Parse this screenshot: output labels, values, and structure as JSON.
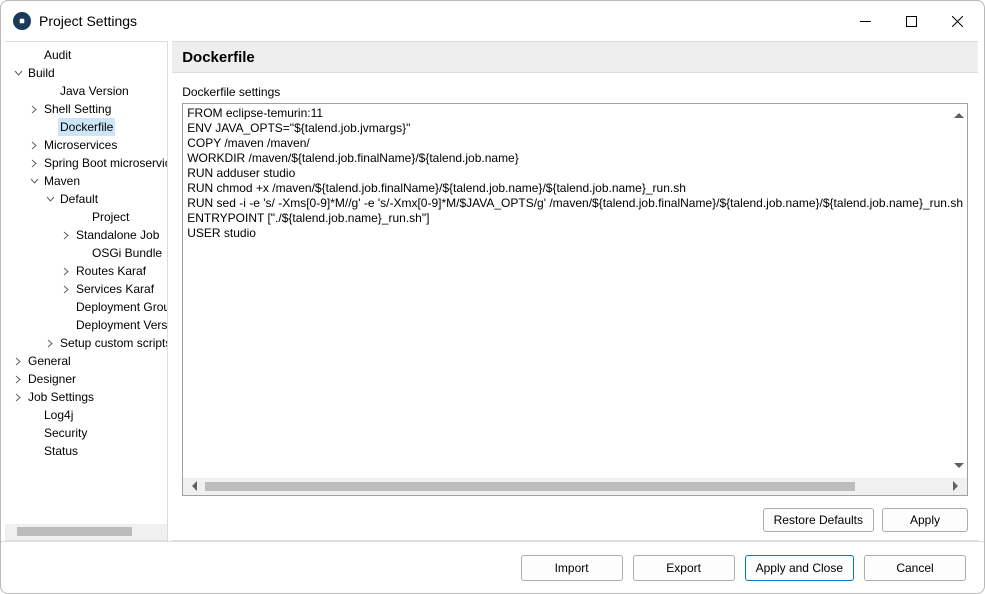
{
  "window": {
    "title": "Project Settings",
    "controls": {
      "minimize": "Minimize",
      "maximize": "Maximize",
      "close": "Close"
    }
  },
  "tree": {
    "items": [
      {
        "label": "Audit",
        "indent": 1,
        "exp": ""
      },
      {
        "label": "Build",
        "indent": 0,
        "exp": "open"
      },
      {
        "label": "Java Version",
        "indent": 2,
        "exp": ""
      },
      {
        "label": "Shell Setting",
        "indent": 1,
        "exp": "closed"
      },
      {
        "label": "Dockerfile",
        "indent": 2,
        "exp": "",
        "selected": true
      },
      {
        "label": "Microservices",
        "indent": 1,
        "exp": "closed"
      },
      {
        "label": "Spring Boot microservices (Deprecated)",
        "indent": 1,
        "exp": "closed"
      },
      {
        "label": "Maven",
        "indent": 1,
        "exp": "open"
      },
      {
        "label": "Default",
        "indent": 2,
        "exp": "open"
      },
      {
        "label": "Project",
        "indent": 4,
        "exp": ""
      },
      {
        "label": "Standalone Job",
        "indent": 3,
        "exp": "closed"
      },
      {
        "label": "OSGi Bundle",
        "indent": 4,
        "exp": ""
      },
      {
        "label": "Routes Karaf",
        "indent": 3,
        "exp": "closed"
      },
      {
        "label": "Services Karaf",
        "indent": 3,
        "exp": "closed"
      },
      {
        "label": "Deployment GroupId",
        "indent": 3,
        "exp": ""
      },
      {
        "label": "Deployment Versioning",
        "indent": 3,
        "exp": ""
      },
      {
        "label": "Setup custom scripts by folder",
        "indent": 2,
        "exp": "closed"
      },
      {
        "label": "General",
        "indent": 0,
        "exp": "closed"
      },
      {
        "label": "Designer",
        "indent": 0,
        "exp": "closed"
      },
      {
        "label": "Job Settings",
        "indent": 0,
        "exp": "closed"
      },
      {
        "label": "Log4j",
        "indent": 1,
        "exp": ""
      },
      {
        "label": "Security",
        "indent": 1,
        "exp": ""
      },
      {
        "label": "Status",
        "indent": 1,
        "exp": ""
      }
    ]
  },
  "content": {
    "header": "Dockerfile",
    "settings_label": "Dockerfile settings",
    "editor_text": "FROM eclipse-temurin:11\nENV JAVA_OPTS=\"${talend.job.jvmargs}\"\nCOPY /maven /maven/\nWORKDIR /maven/${talend.job.finalName}/${talend.job.name}\nRUN adduser studio\nRUN chmod +x /maven/${talend.job.finalName}/${talend.job.name}/${talend.job.name}_run.sh\nRUN sed -i -e 's/ -Xms[0-9]*M//g' -e 's/-Xmx[0-9]*M/$JAVA_OPTS/g' /maven/${talend.job.finalName}/${talend.job.name}/${talend.job.name}_run.sh\nENTRYPOINT [\"./${talend.job.name}_run.sh\"]\nUSER studio",
    "restore_defaults": "Restore Defaults",
    "apply": "Apply"
  },
  "buttons": {
    "import": "Import",
    "export": "Export",
    "apply_close": "Apply and Close",
    "cancel": "Cancel"
  }
}
